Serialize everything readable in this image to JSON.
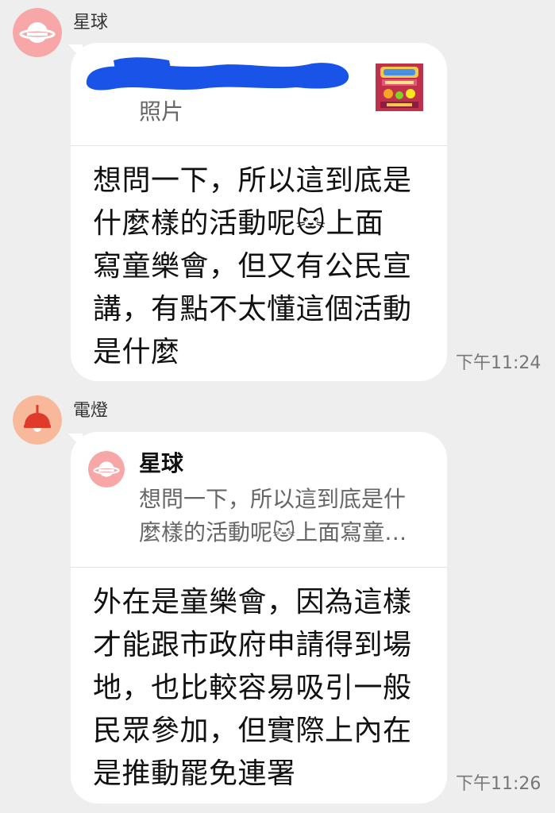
{
  "messages": [
    {
      "sender": "星球",
      "quote": {
        "type": "photo",
        "label": "照片"
      },
      "text": "想問一下，所以這到底是\n什麼樣的活動呢🐱上面\n寫童樂會，但又有公民宣\n講，有點不太懂這個活動\n是什麼",
      "time": "下午11:24"
    },
    {
      "sender": "電燈",
      "reply": {
        "name": "星球",
        "text": "想問一下，所以這到底是什\n麼樣的活動呢🐱上面寫童…"
      },
      "text": "外在是童樂會，因為這樣\n才能跟市政府申請得到場\n地，也比較容易吸引一般\n民眾參加，但實際上內在\n是推動罷免連署",
      "time": "下午11:26"
    }
  ],
  "colors": {
    "background": "#eeeeef",
    "bubble": "#ffffff",
    "planet_avatar_bg": "#f7a7a7",
    "lamp_avatar_bg": "#f8b99a",
    "redaction": "#1a53e8"
  },
  "icons": {
    "avatar1": "planet-icon",
    "avatar2": "lamp-icon",
    "emoji": "cat-emoji-icon"
  }
}
